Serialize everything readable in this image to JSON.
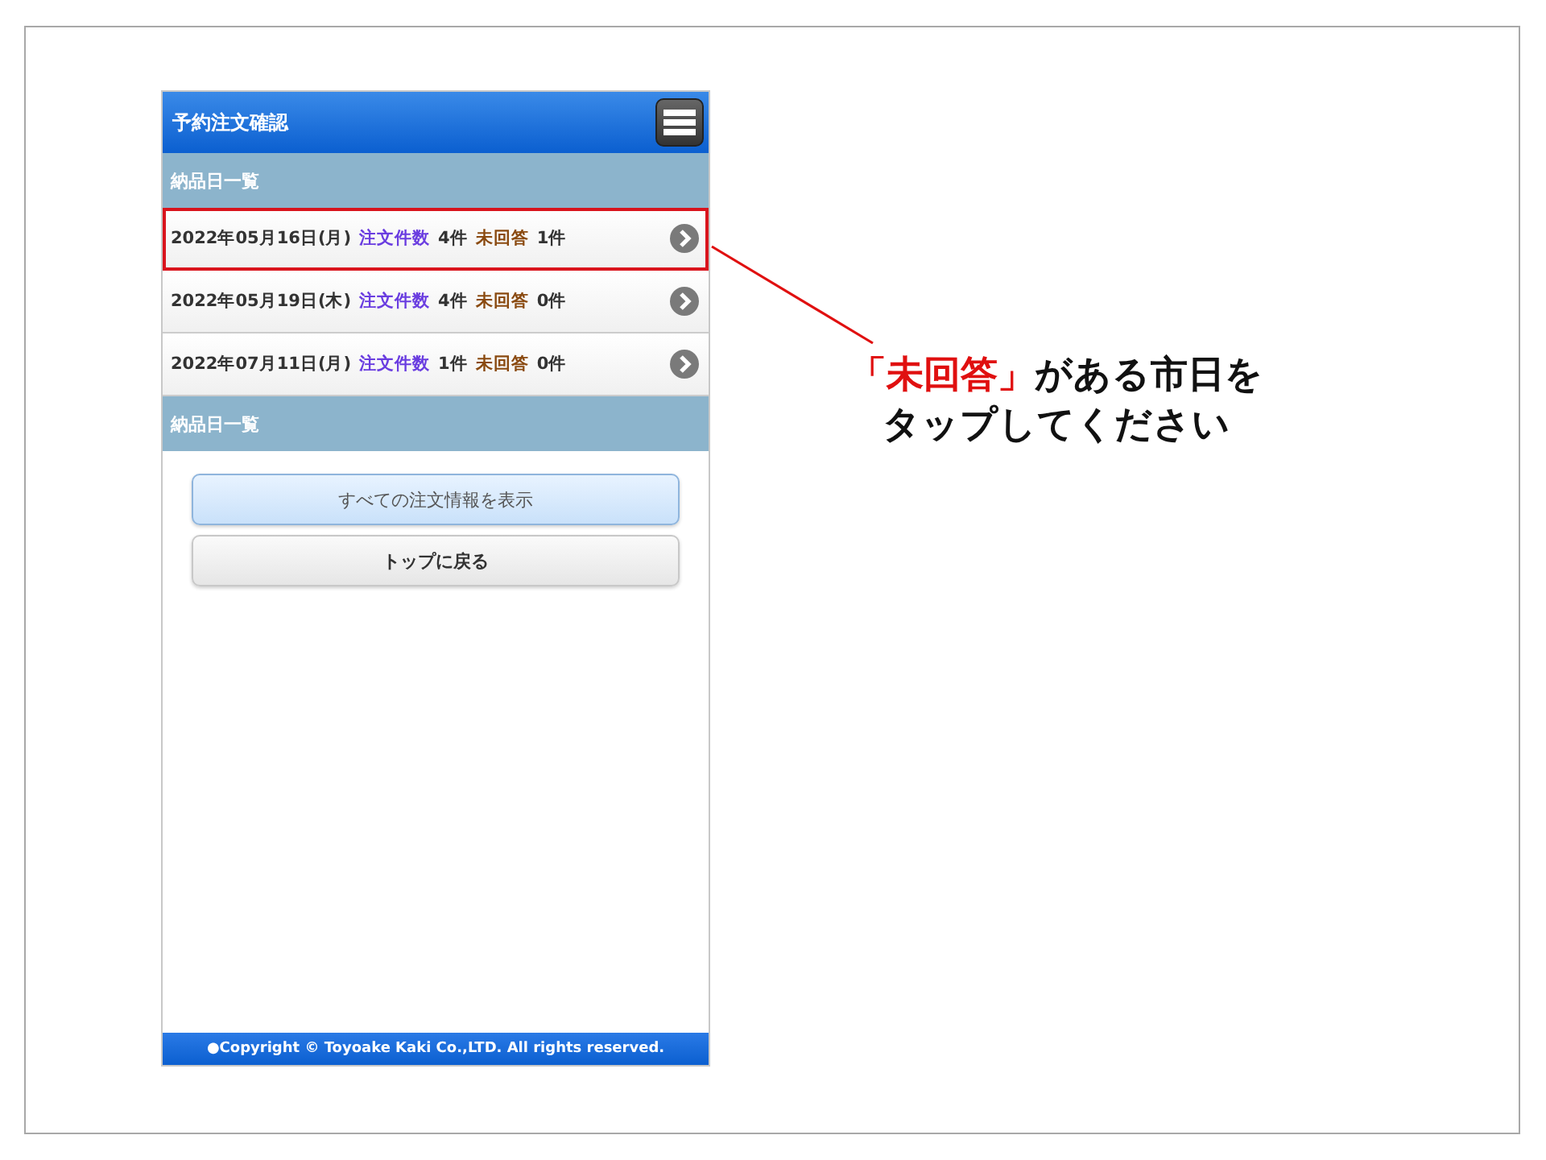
{
  "app": {
    "title": "予約注文確認",
    "sections": [
      {
        "heading": "納品日一覧",
        "rows": [
          {
            "date": "2022年05月16日(月)",
            "order_label": "注文件数",
            "order_count": "4件",
            "unanswered_label": "未回答",
            "unanswered_count": "1件",
            "highlighted": true
          },
          {
            "date": "2022年05月19日(木)",
            "order_label": "注文件数",
            "order_count": "4件",
            "unanswered_label": "未回答",
            "unanswered_count": "0件",
            "highlighted": false
          },
          {
            "date": "2022年07月11日(月)",
            "order_label": "注文件数",
            "order_count": "1件",
            "unanswered_label": "未回答",
            "unanswered_count": "0件",
            "highlighted": false
          }
        ]
      },
      {
        "heading": "納品日一覧"
      }
    ],
    "buttons": [
      {
        "label": "すべての注文情報を表示",
        "kind": "primary"
      },
      {
        "label": "トップに戻る",
        "kind": "default"
      }
    ],
    "footer": "●Copyright © Toyoake Kaki Co.,LTD. All rights reserved."
  },
  "callout": {
    "highlight": "「未回答」",
    "line_1": "がある市日を",
    "line_2": "タップしてください"
  }
}
